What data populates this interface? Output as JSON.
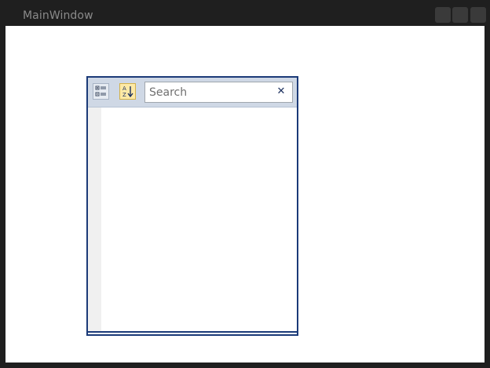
{
  "window": {
    "title": "MainWindow"
  },
  "property_grid": {
    "toolbar": {
      "categorized_icon": "categorized-icon",
      "alphabetical_icon": "sort-alphabetical-icon",
      "alphabetical_active": true
    },
    "search": {
      "value": "",
      "placeholder": "Search",
      "clear_glyph": "✕"
    }
  },
  "colors": {
    "frame": "#1f1f1f",
    "grid_border": "#1b3a78",
    "toolbar_bg": "#cfd8e5",
    "active_button_bg": "#fde9a6"
  }
}
